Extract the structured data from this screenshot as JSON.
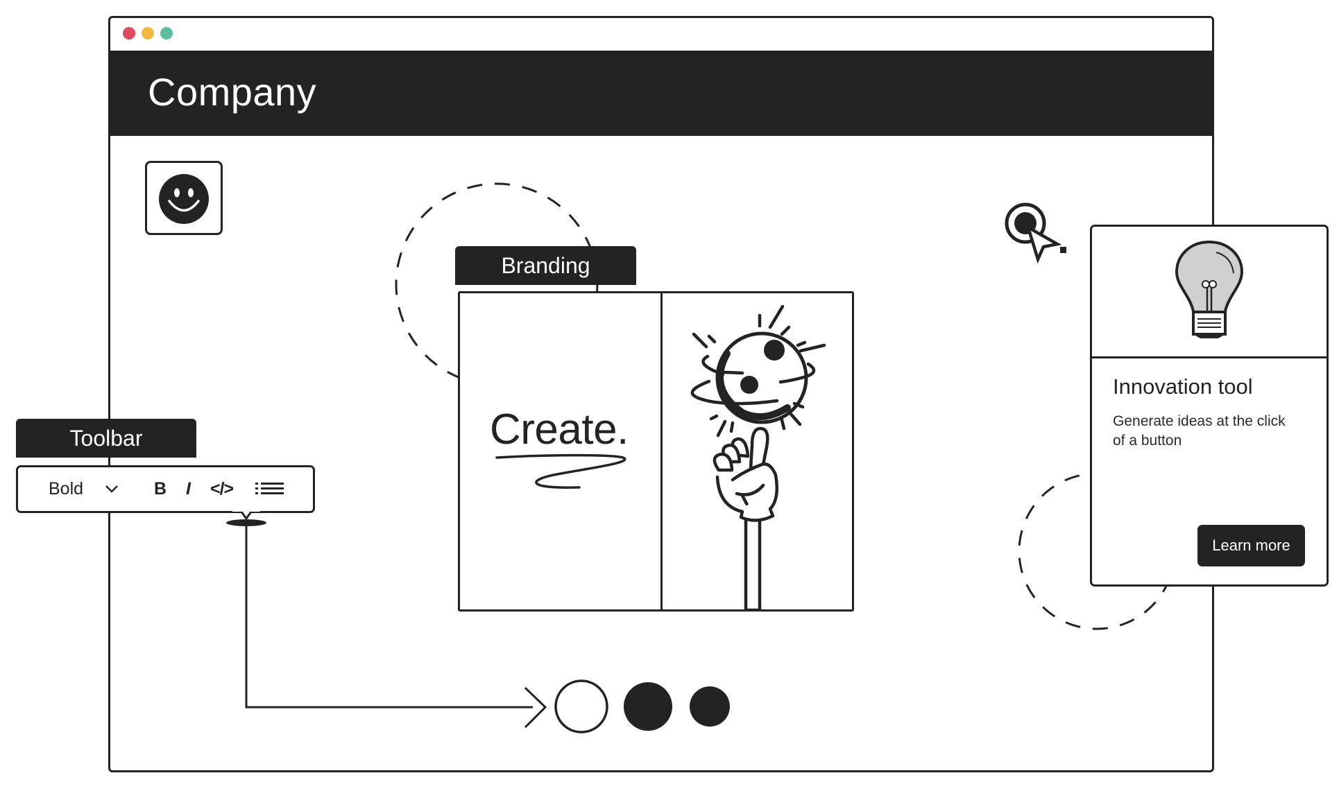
{
  "window": {
    "traffic_lights": [
      {
        "name": "close",
        "color": "#e04a5f"
      },
      {
        "name": "minimize",
        "color": "#f1b941"
      },
      {
        "name": "maximize",
        "color": "#5bbf9f"
      }
    ],
    "header_title": "Company"
  },
  "branding": {
    "tab_label": "Branding",
    "headline": "Create."
  },
  "toolbar": {
    "tab_label": "Toolbar",
    "font_style_value": "Bold",
    "bold_label": "B",
    "italic_label": "I",
    "code_label": "</>",
    "icons": {
      "dropdown": "chevron-down-icon",
      "list": "bullet-list-icon"
    }
  },
  "card": {
    "title": "Innovation tool",
    "body": "Generate ideas at the click of a button",
    "button_label": "Learn more",
    "icon": "lightbulb-icon"
  },
  "colors": {
    "ink": "#232323",
    "background": "#ffffff",
    "bulb_fill": "#d0d0d0"
  },
  "pagination": {
    "dots": [
      {
        "state": "current"
      },
      {
        "state": "filled"
      },
      {
        "state": "filled"
      }
    ]
  }
}
